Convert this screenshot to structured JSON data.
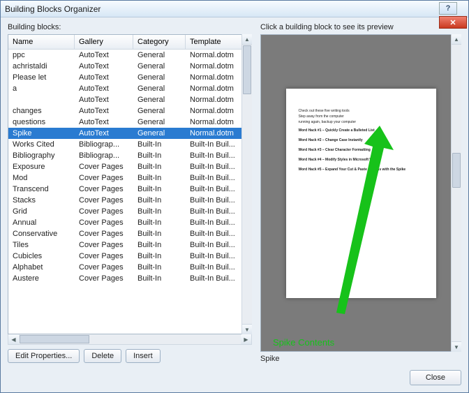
{
  "title": "Building Blocks Organizer",
  "leftLabel": "Building blocks:",
  "rightLabel": "Click a building block to see its preview",
  "columns": [
    "Name",
    "Gallery",
    "Category",
    "Template"
  ],
  "rows": [
    {
      "name": "ppc",
      "gallery": "AutoText",
      "category": "General",
      "template": "Normal.dotm",
      "selected": false
    },
    {
      "name": "achristaldi",
      "gallery": "AutoText",
      "category": "General",
      "template": "Normal.dotm",
      "selected": false
    },
    {
      "name": "Please let",
      "gallery": "AutoText",
      "category": "General",
      "template": "Normal.dotm",
      "selected": false
    },
    {
      "name": "a",
      "gallery": "AutoText",
      "category": "General",
      "template": "Normal.dotm",
      "selected": false
    },
    {
      "name": "",
      "gallery": "AutoText",
      "category": "General",
      "template": "Normal.dotm",
      "selected": false
    },
    {
      "name": "changes",
      "gallery": "AutoText",
      "category": "General",
      "template": "Normal.dotm",
      "selected": false
    },
    {
      "name": "questions",
      "gallery": "AutoText",
      "category": "General",
      "template": "Normal.dotm",
      "selected": false
    },
    {
      "name": "Spike",
      "gallery": "AutoText",
      "category": "General",
      "template": "Normal.dotm",
      "selected": true
    },
    {
      "name": "Works Cited",
      "gallery": "Bibliograp...",
      "category": "Built-In",
      "template": "Built-In Buil...",
      "selected": false
    },
    {
      "name": "Bibliography",
      "gallery": "Bibliograp...",
      "category": "Built-In",
      "template": "Built-In Buil...",
      "selected": false
    },
    {
      "name": "Exposure",
      "gallery": "Cover Pages",
      "category": "Built-In",
      "template": "Built-In Buil...",
      "selected": false
    },
    {
      "name": "Mod",
      "gallery": "Cover Pages",
      "category": "Built-In",
      "template": "Built-In Buil...",
      "selected": false
    },
    {
      "name": "Transcend",
      "gallery": "Cover Pages",
      "category": "Built-In",
      "template": "Built-In Buil...",
      "selected": false
    },
    {
      "name": "Stacks",
      "gallery": "Cover Pages",
      "category": "Built-In",
      "template": "Built-In Buil...",
      "selected": false
    },
    {
      "name": "Grid",
      "gallery": "Cover Pages",
      "category": "Built-In",
      "template": "Built-In Buil...",
      "selected": false
    },
    {
      "name": "Annual",
      "gallery": "Cover Pages",
      "category": "Built-In",
      "template": "Built-In Buil...",
      "selected": false
    },
    {
      "name": "Conservative",
      "gallery": "Cover Pages",
      "category": "Built-In",
      "template": "Built-In Buil...",
      "selected": false
    },
    {
      "name": "Tiles",
      "gallery": "Cover Pages",
      "category": "Built-In",
      "template": "Built-In Buil...",
      "selected": false
    },
    {
      "name": "Cubicles",
      "gallery": "Cover Pages",
      "category": "Built-In",
      "template": "Built-In Buil...",
      "selected": false
    },
    {
      "name": "Alphabet",
      "gallery": "Cover Pages",
      "category": "Built-In",
      "template": "Built-In Buil...",
      "selected": false
    },
    {
      "name": "Austere",
      "gallery": "Cover Pages",
      "category": "Built-In",
      "template": "Built-In Buil...",
      "selected": false
    }
  ],
  "buttons": {
    "edit": "Edit Properties...",
    "delete": "Delete",
    "insert": "Insert",
    "close": "Close"
  },
  "previewName": "Spike",
  "previewLines": [
    "Check out these five writing tools",
    "Step away from the computer",
    "running again, backup your computer",
    "Word Hack #1 – Quickly Create a Bulleted List",
    "Word Hack #2 – Change Case Instantly",
    "Word Hack #3 – Clear Character Formatting",
    "Word Hack #4 – Modify Styles in Microsoft Word",
    "Word Hack #5 – Expand Your Cut & Paste Options with the Spike"
  ],
  "annotation": "Spike Contents"
}
